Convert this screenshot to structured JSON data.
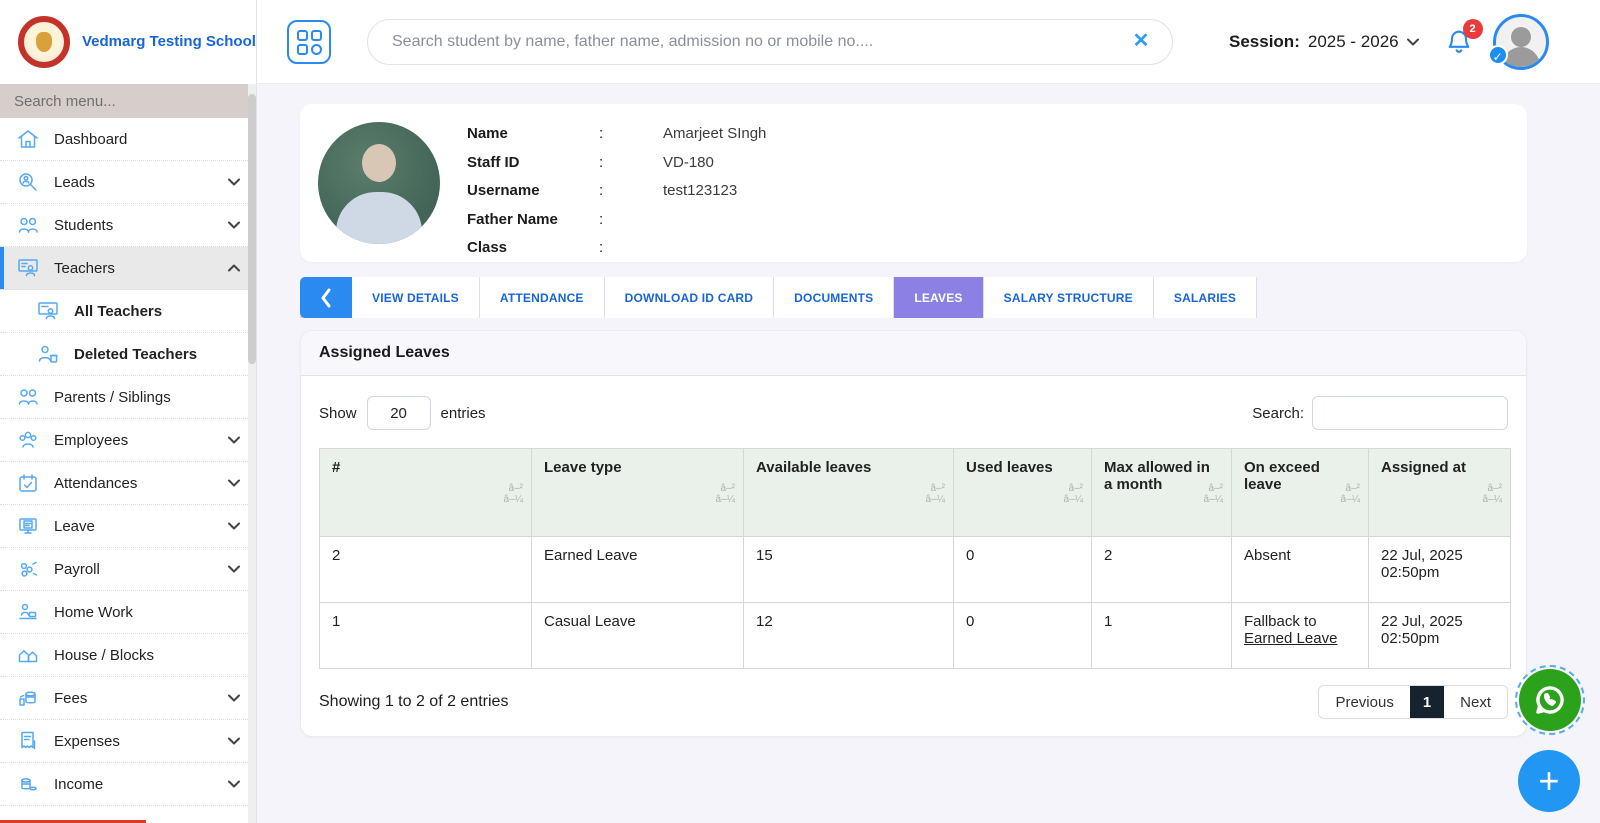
{
  "brand": {
    "school_name": "Vedmarg Testing School"
  },
  "topbar": {
    "search_placeholder": "Search student by name, father name, admission no or mobile no....",
    "clear_icon": "✕",
    "session_label": "Session:",
    "session_value": "2025 - 2026",
    "notification_count": "2",
    "verify_check": "✓"
  },
  "sidebar": {
    "search_placeholder": "Search menu...",
    "items": [
      {
        "label": "Dashboard"
      },
      {
        "label": "Leads"
      },
      {
        "label": "Students"
      },
      {
        "label": "Teachers"
      },
      {
        "label": "All Teachers"
      },
      {
        "label": "Deleted Teachers"
      },
      {
        "label": "Parents / Siblings"
      },
      {
        "label": "Employees"
      },
      {
        "label": "Attendances"
      },
      {
        "label": "Leave"
      },
      {
        "label": "Payroll"
      },
      {
        "label": "Home Work"
      },
      {
        "label": "House / Blocks"
      },
      {
        "label": "Fees"
      },
      {
        "label": "Expenses"
      },
      {
        "label": "Income"
      }
    ]
  },
  "profile": {
    "colon": ":",
    "fields": [
      {
        "label": "Name",
        "value": "Amarjeet SIngh"
      },
      {
        "label": "Staff ID",
        "value": "VD-180"
      },
      {
        "label": "Username",
        "value": "test123123"
      },
      {
        "label": "Father Name",
        "value": ""
      },
      {
        "label": "Class",
        "value": ""
      }
    ]
  },
  "tabs": {
    "items": [
      {
        "label": "VIEW DETAILS"
      },
      {
        "label": "ATTENDANCE"
      },
      {
        "label": "DOWNLOAD ID CARD"
      },
      {
        "label": "DOCUMENTS"
      },
      {
        "label": "LEAVES"
      },
      {
        "label": "SALARY STRUCTURE"
      },
      {
        "label": "SALARIES"
      }
    ],
    "active": "LEAVES"
  },
  "leaves_panel": {
    "title": "Assigned Leaves",
    "show_label": "Show",
    "entries_value": "20",
    "entries_label": "entries",
    "search_label": "Search:",
    "table": {
      "sort_up": "â–²",
      "sort_down": "â–¼",
      "headers": [
        "#",
        "Leave type",
        "Available leaves",
        "Used leaves",
        "Max allowed in a month",
        "On exceed leave",
        "Assigned at"
      ],
      "rows": [
        {
          "num": "2",
          "type": "Earned Leave",
          "available": "15",
          "used": "0",
          "max": "2",
          "exceed_text": "Absent",
          "exceed_link": "",
          "date": "22 Jul, 2025",
          "time": "02:50pm"
        },
        {
          "num": "1",
          "type": "Casual Leave",
          "available": "12",
          "used": "0",
          "max": "1",
          "exceed_text": "Fallback to",
          "exceed_link": "Earned Leave",
          "date": "22 Jul, 2025",
          "time": "02:50pm"
        }
      ]
    },
    "footer": {
      "info": "Showing 1 to 2 of 2 entries",
      "previous": "Previous",
      "page": "1",
      "next": "Next"
    }
  },
  "colors": {
    "accent_blue": "#2a8af0",
    "tab_active_purple": "#8d80e4",
    "table_header_green": "#eaf1ea",
    "pager_current_dark": "#16222e",
    "whatsapp_green": "#2ba11c",
    "notification_red": "#e83b3b"
  }
}
